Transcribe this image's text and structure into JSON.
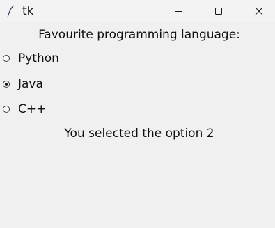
{
  "window": {
    "title": "tk",
    "controls": {
      "minimize": "minimize-icon",
      "maximize": "maximize-icon",
      "close": "close-icon"
    }
  },
  "form": {
    "heading": "Favourite programming language:",
    "options": [
      {
        "label": "Python",
        "selected": false
      },
      {
        "label": "Java",
        "selected": true
      },
      {
        "label": "C++",
        "selected": false
      }
    ],
    "result_text": "You selected the option 2"
  }
}
